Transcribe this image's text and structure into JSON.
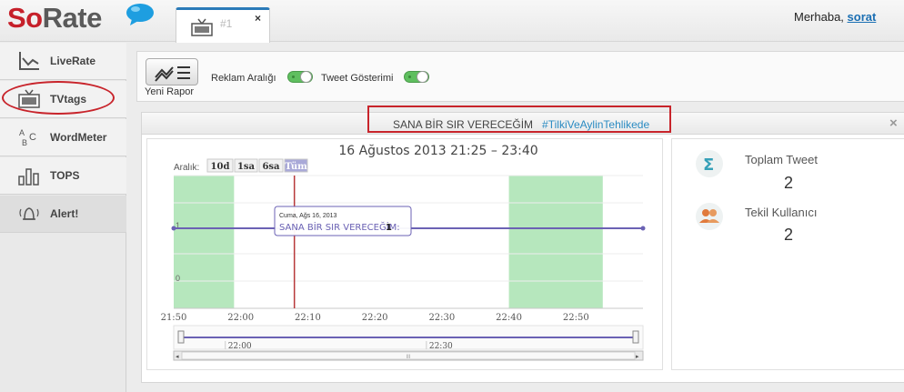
{
  "header": {
    "logo_so": "So",
    "logo_rate": "Rate",
    "tab_label": "#1",
    "tab_close": "×",
    "greeting_prefix": "Merhaba,",
    "greeting_user": "sorat"
  },
  "sidebar": {
    "items": [
      {
        "label": "LiveRate",
        "icon": "line-chart-icon"
      },
      {
        "label": "TVtags",
        "icon": "tv-icon"
      },
      {
        "label": "WordMeter",
        "icon": "abc-icon"
      },
      {
        "label": "TOPS",
        "icon": "bar-chart-icon"
      },
      {
        "label": "Alert!",
        "icon": "bell-icon"
      }
    ]
  },
  "toolbar": {
    "report_label": "Yeni Rapor",
    "toggle1_label": "Reklam Aralığı",
    "toggle2_label": "Tweet Gösterimi"
  },
  "panel": {
    "title": "SANA BİR SIR VERECEĞİM",
    "hashtag": "#TilkiVeAylinTehlikede",
    "close": "×"
  },
  "stats": {
    "total_label": "Toplam Tweet",
    "total_value": "2",
    "unique_label": "Tekil Kullanıcı",
    "unique_value": "2"
  },
  "colors": {
    "brand_red": "#c6202a",
    "accent_blue": "#2a8bc2",
    "series": "#6b62b4",
    "ad_band": "#b6e7bd",
    "cursor": "#b8393a"
  },
  "chart_data": {
    "type": "line",
    "title": "16 Ağustos 2013 21:25 – 23:40",
    "range_label": "Aralık:",
    "range_buttons": [
      "10d",
      "1sa",
      "6sa",
      "Tüm"
    ],
    "selected_range": "Tüm",
    "x_ticks": [
      "21:50",
      "22:00",
      "22:10",
      "22:20",
      "22:30",
      "22:40",
      "22:50"
    ],
    "y_ticks": [
      "0",
      "1"
    ],
    "ylim": [
      0,
      1
    ],
    "series": [
      {
        "name": "SANA BİR SIR VERECEĞİM",
        "x": [
          "21:50",
          "23:00"
        ],
        "y": [
          1,
          1
        ]
      }
    ],
    "ad_bands": [
      [
        "21:50",
        "21:59"
      ],
      [
        "22:40",
        "22:54"
      ]
    ],
    "cursor_time": "22:08",
    "tooltip": {
      "date": "Cuma, Ağs 16, 2013",
      "series": "SANA BİR SIR VERECEĞİM:",
      "value": "1"
    },
    "navigator_ticks": [
      "22:00",
      "22:30"
    ],
    "scrollbar_mark": "III"
  }
}
